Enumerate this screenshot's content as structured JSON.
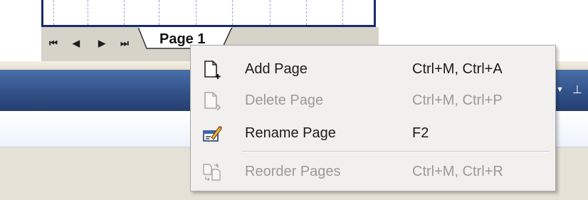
{
  "tab_strip": {
    "nav": [
      {
        "name": "first-page-button",
        "glyph": "⏮"
      },
      {
        "name": "prev-page-button",
        "glyph": "◀"
      },
      {
        "name": "next-page-button",
        "glyph": "▶"
      },
      {
        "name": "last-page-button",
        "glyph": "⏭"
      }
    ],
    "page_tab_label": "Page 1"
  },
  "context_menu": {
    "items": [
      {
        "label": "Add Page",
        "shortcut": "Ctrl+M, Ctrl+A",
        "enabled": true,
        "icon": "add-page-icon"
      },
      {
        "label": "Delete Page",
        "shortcut": "Ctrl+M, Ctrl+P",
        "enabled": false,
        "icon": "delete-page-icon"
      },
      {
        "label": "Rename Page",
        "shortcut": "F2",
        "enabled": true,
        "icon": "rename-page-icon"
      },
      {
        "label": "Reorder Pages",
        "shortcut": "Ctrl+M, Ctrl+R",
        "enabled": false,
        "icon": "reorder-pages-icon"
      }
    ]
  },
  "titlebar": {
    "icons": [
      "dropdown-arrow-icon",
      "pin-icon"
    ]
  },
  "colors": {
    "titlebar": "#2f4f86",
    "menu_background": "#f2f0ee",
    "disabled_text": "#9a9a9a",
    "canvas_border": "#1a2a6b"
  }
}
